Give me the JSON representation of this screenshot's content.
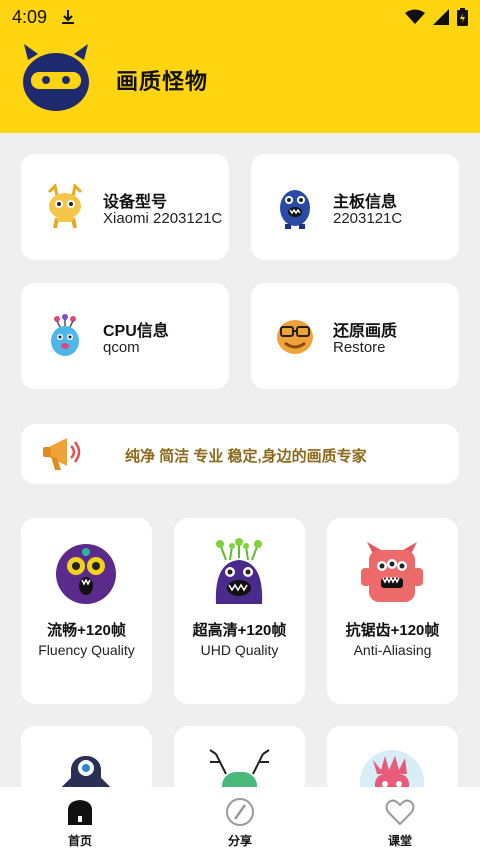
{
  "status_bar": {
    "time": "4:09",
    "icons": [
      "download-icon",
      "wifi-icon",
      "signal-icon",
      "battery-icon"
    ]
  },
  "header": {
    "title": "画质怪物",
    "logo": "monster-logo",
    "background_color": "#ffd512"
  },
  "info_cards": [
    {
      "title": "设备型号",
      "value": "Xiaomi 2203121C",
      "icon": "yellow-monster-icon"
    },
    {
      "title": "主板信息",
      "value": "2203121C",
      "icon": "blue-monster-icon"
    },
    {
      "title": "CPU信息",
      "value": "qcom",
      "icon": "balloon-monster-icon"
    },
    {
      "title": "还原画质",
      "value": "Restore",
      "icon": "orange-monster-icon"
    }
  ],
  "banner": {
    "text": "纯净 简洁 专业 稳定,身边的画质专家",
    "icon": "megaphone-icon"
  },
  "modes": [
    {
      "title": "流畅+120帧",
      "subtitle": "Fluency Quality",
      "icon": "purple-monster-icon"
    },
    {
      "title": "超高清+120帧",
      "subtitle": "UHD Quality",
      "icon": "antenna-monster-icon"
    },
    {
      "title": "抗锯齿+120帧",
      "subtitle": "Anti-Aliasing",
      "icon": "red-monster-icon"
    }
  ],
  "more_modes_icons": [
    "cyclops-monster-icon",
    "antler-monster-icon",
    "pink-monster-icon"
  ],
  "bottom_nav": [
    {
      "label": "首页",
      "icon": "home-icon",
      "active": true
    },
    {
      "label": "分享",
      "icon": "compass-icon",
      "active": false
    },
    {
      "label": "课堂",
      "icon": "heart-icon",
      "active": false
    }
  ]
}
